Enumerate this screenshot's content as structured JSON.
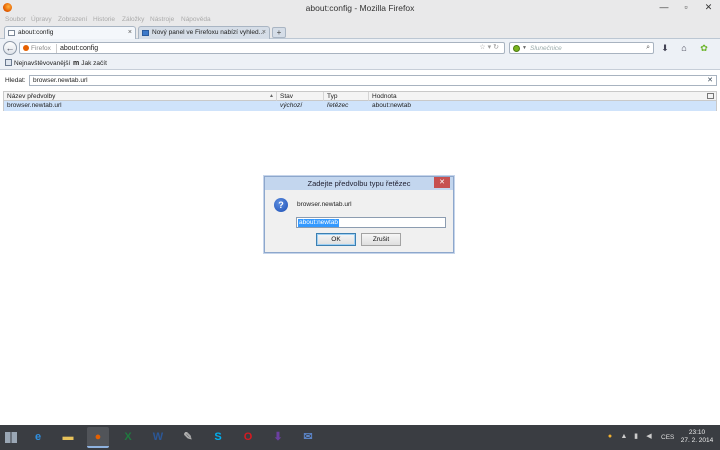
{
  "window": {
    "title": "about:config - Mozilla Firefox"
  },
  "menubar": [
    "Soubor",
    "Úpravy",
    "Zobrazení",
    "Historie",
    "Záložky",
    "Nástroje",
    "Nápověda"
  ],
  "tabs": [
    {
      "label": "about:config",
      "active": true
    },
    {
      "label": "Nový panel ve Firefoxu nabízí vyhled...",
      "active": false
    }
  ],
  "navbar": {
    "identity_label": "Firefox",
    "url": "about:config",
    "search_placeholder": "Slunečnice"
  },
  "bookmarks": [
    {
      "label": "Nejnavštěvovanější",
      "icon": "folder-icon"
    },
    {
      "label": "Jak začít",
      "icon": "mozilla-icon"
    }
  ],
  "filter": {
    "label": "Hledat:",
    "value": "browser.newtab.url"
  },
  "table": {
    "headers": [
      "Název předvolby",
      "Stav",
      "Typ",
      "Hodnota"
    ],
    "rows": [
      {
        "name": "browser.newtab.url",
        "status": "výchozí",
        "type": "řetězec",
        "value": "about:newtab"
      }
    ]
  },
  "dialog": {
    "title": "Zadejte předvolbu typu řetězec",
    "prompt": "browser.newtab.url",
    "input_value": "about:newtab",
    "ok_label": "OK",
    "cancel_label": "Zrušit"
  },
  "taskbar": {
    "apps": [
      {
        "icon": "ie-icon",
        "glyph": "e",
        "color": "#2f8fe0"
      },
      {
        "icon": "explorer-icon",
        "glyph": "▬",
        "color": "#e8c35a"
      },
      {
        "icon": "firefox-icon",
        "glyph": "●",
        "color": "#e66000"
      },
      {
        "icon": "excel-icon",
        "glyph": "X",
        "color": "#1f7a3f"
      },
      {
        "icon": "word-icon",
        "glyph": "W",
        "color": "#2b5797"
      },
      {
        "icon": "paint-icon",
        "glyph": "✎",
        "color": "#b0b0b0"
      },
      {
        "icon": "skype-icon",
        "glyph": "S",
        "color": "#00aff0"
      },
      {
        "icon": "opera-icon",
        "glyph": "O",
        "color": "#d71920"
      },
      {
        "icon": "download-icon",
        "glyph": "⬇",
        "color": "#6b3fa0"
      },
      {
        "icon": "thunderbird-icon",
        "glyph": "✉",
        "color": "#5a83c5"
      }
    ],
    "language": "CES",
    "time": "23:10",
    "date": "27. 2. 2014"
  }
}
